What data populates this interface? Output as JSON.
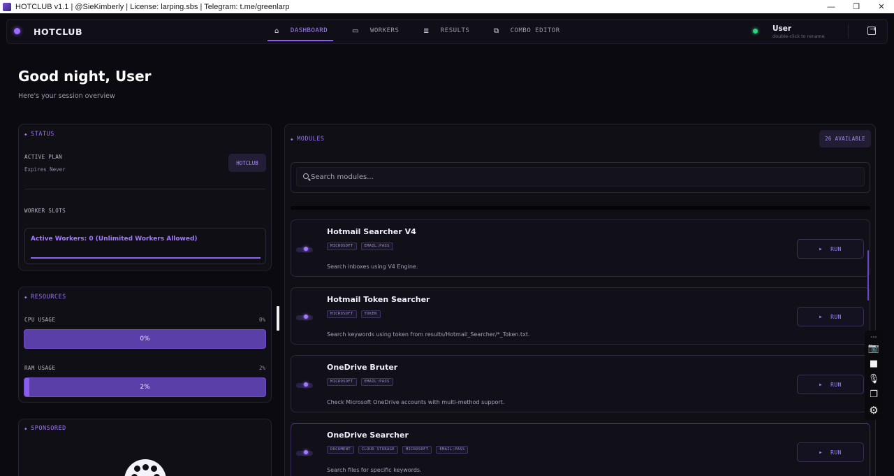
{
  "window": {
    "title": "HOTCLUB v1.1 | @SieKimberly | License: larping.sbs | Telegram: t.me/greenlarp",
    "minimize": "—",
    "maximize": "❐",
    "close": "✕"
  },
  "nav": {
    "brand": "HOTCLUB",
    "tabs": [
      {
        "label": "DASHBOARD",
        "icon": "home-icon",
        "glyph": "⌂"
      },
      {
        "label": "WORKERS",
        "icon": "monitor-icon",
        "glyph": "▭"
      },
      {
        "label": "RESULTS",
        "icon": "list-icon",
        "glyph": "≣"
      },
      {
        "label": "COMBO EDITOR",
        "icon": "copy-icon",
        "glyph": "⧉"
      }
    ],
    "active_tab": "DASHBOARD",
    "user": {
      "name": "User",
      "hint": "double-click to rename",
      "status_color": "#2fd27c"
    }
  },
  "greeting": {
    "title": "Good night,  User",
    "subtitle": "Here's your session overview"
  },
  "status": {
    "title": "STATUS",
    "plan_label": "ACTIVE PLAN",
    "expires": "Expires Never",
    "plan_badge": "HOTCLUB",
    "slots_label": "WORKER SLOTS",
    "workers_text": "Active Workers: 0  (Unlimited Workers Allowed)"
  },
  "resources": {
    "title": "RESOURCES",
    "cpu": {
      "label": "CPU USAGE",
      "value": "0%",
      "fraction": 0.0
    },
    "ram": {
      "label": "RAM USAGE",
      "value": "2%",
      "fraction": 0.02
    }
  },
  "sponsored": {
    "title": "SPONSORED"
  },
  "modules": {
    "title": "MODULES",
    "available": "26 AVAILABLE",
    "search_placeholder": "Search modules...",
    "run_label": "RUN",
    "play_glyph": "▶",
    "items": [
      {
        "name": "Hotmail Searcher V4",
        "tags": [
          "MICROSOFT",
          "EMAIL:PASS"
        ],
        "description": "Search inboxes using V4 Engine."
      },
      {
        "name": "Hotmail Token Searcher",
        "tags": [
          "MICROSOFT",
          "TOKEN"
        ],
        "description": "Search keywords using token from results/Hotmail_Searcher/*_Token.txt."
      },
      {
        "name": "OneDrive Bruter",
        "tags": [
          "MICROSOFT",
          "EMAIL:PASS"
        ],
        "description": "Check Microsoft OneDrive accounts with multi-method support."
      },
      {
        "name": "OneDrive Searcher",
        "tags": [
          "DOCUMENT",
          "CLOUD STORAGE",
          "MICROSOFT",
          "EMAIL:PASS"
        ],
        "description": "Search files for specific keywords."
      }
    ]
  },
  "tools": [
    {
      "icon": "link-more-icon",
      "glyph": "⋯"
    },
    {
      "icon": "camera-icon",
      "glyph": "📷"
    },
    {
      "icon": "video-icon",
      "glyph": "■"
    },
    {
      "icon": "microphone-icon",
      "glyph": "🎙"
    },
    {
      "icon": "windows-icon",
      "glyph": "❐"
    },
    {
      "icon": "settings-icon",
      "glyph": "⚙"
    }
  ],
  "colors": {
    "accent": "#8a5cf0",
    "background": "#0b0a10",
    "online": "#2fd27c"
  }
}
